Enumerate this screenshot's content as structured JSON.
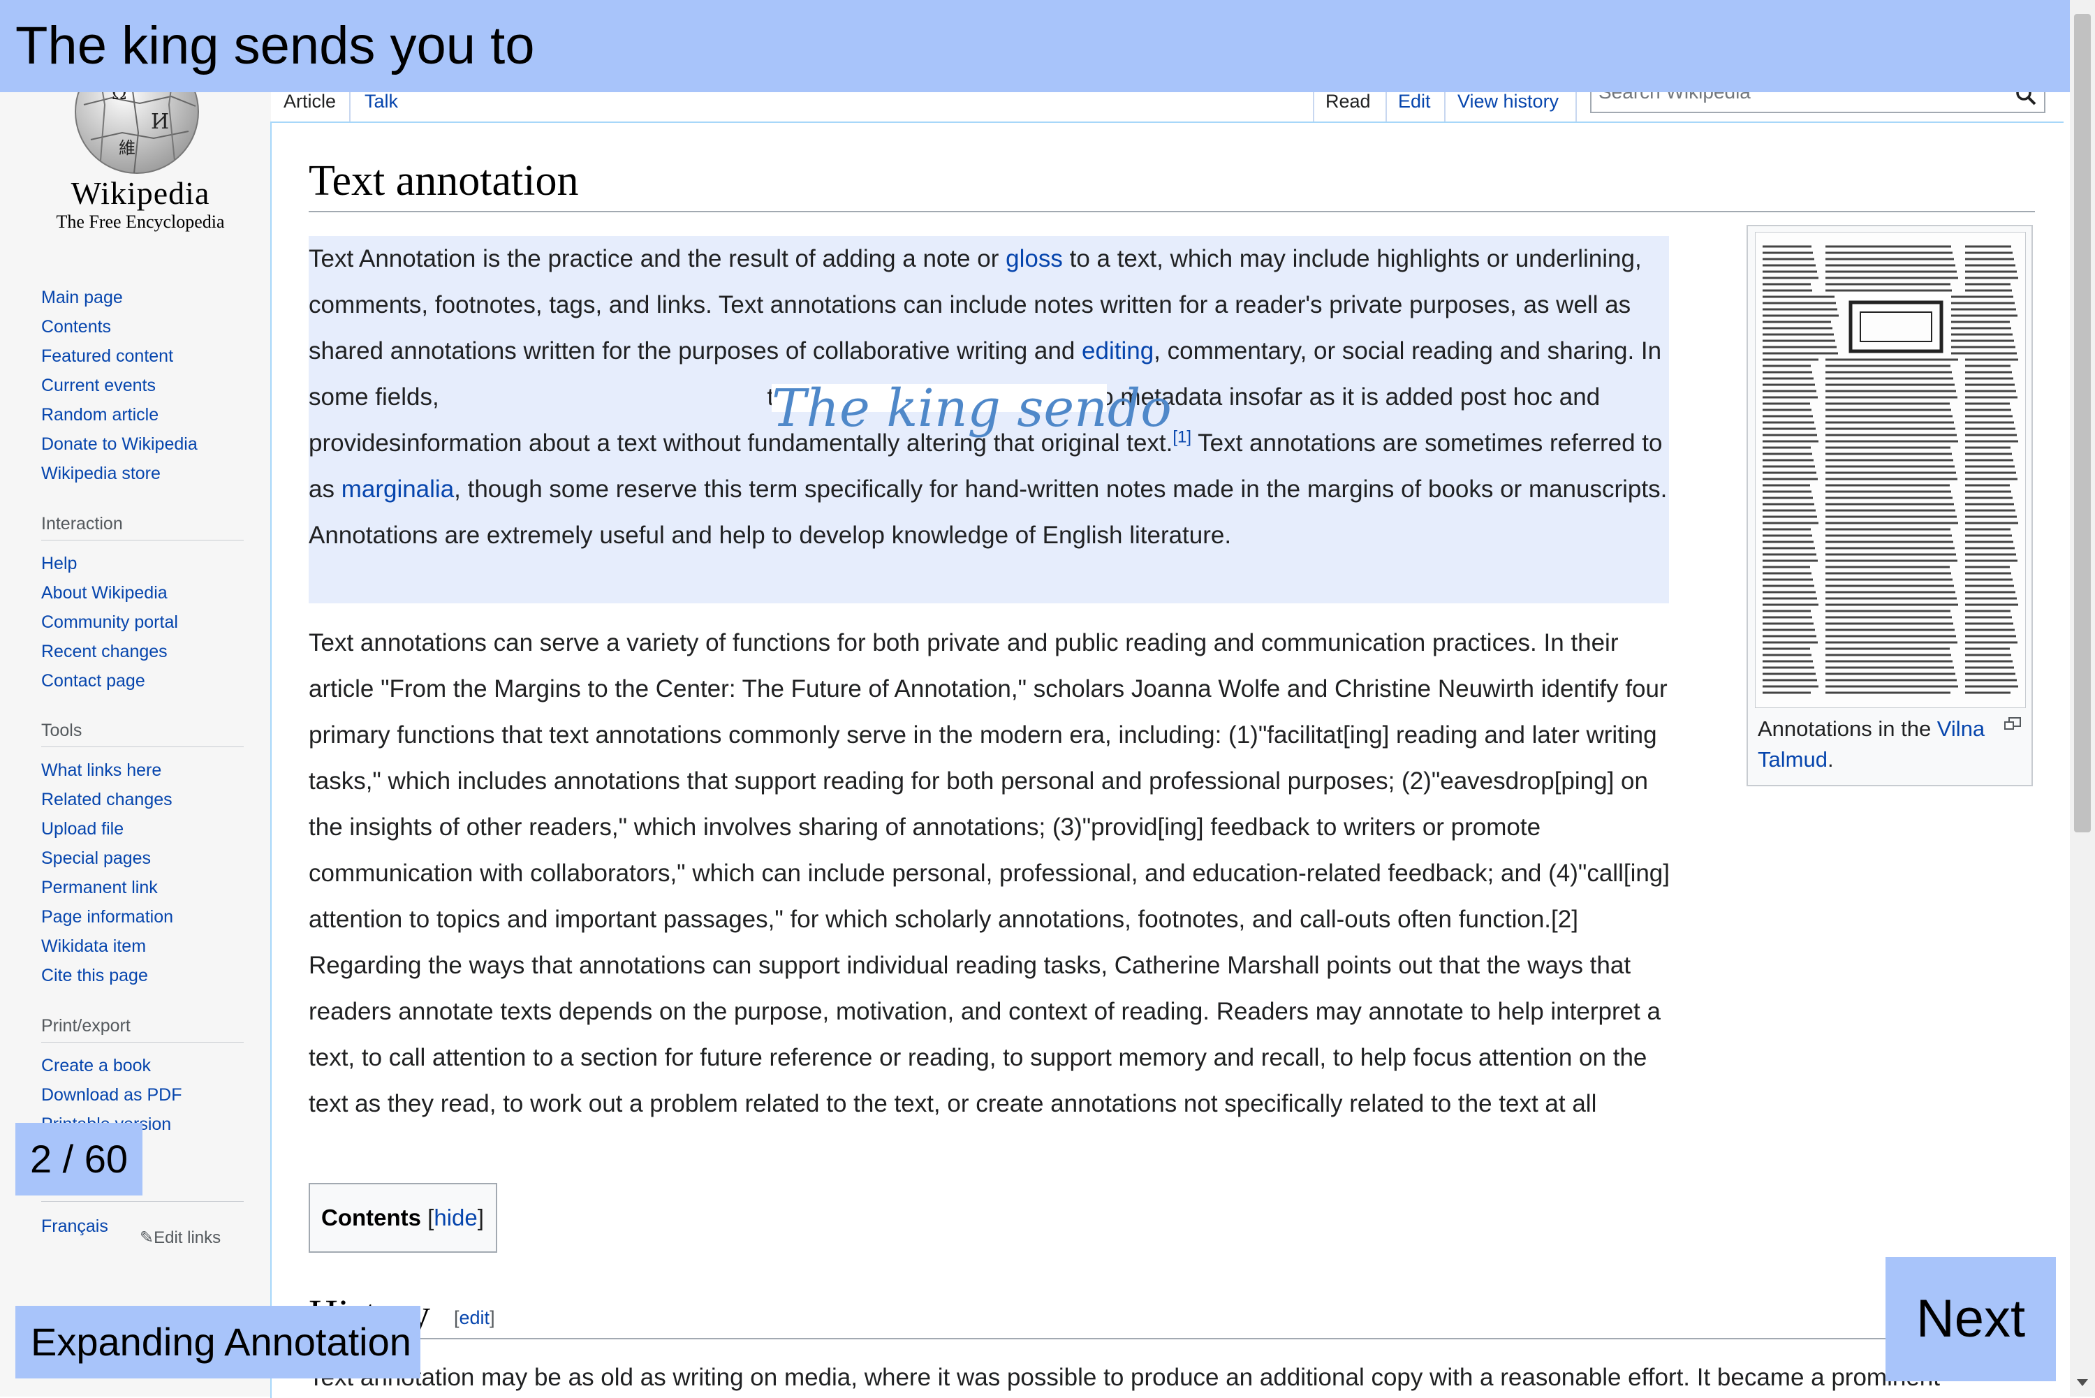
{
  "overlay": {
    "banner_text": "The king sends you to",
    "counter": "2 / 60",
    "mode_label": "Expanding Annotation",
    "next_label": "Next",
    "accent_color": "#a8c4fa"
  },
  "logo": {
    "wordmark": "Wikipedia",
    "tagline": "The Free Encyclopedia"
  },
  "sidebar": {
    "main": [
      "Main page",
      "Contents",
      "Featured content",
      "Current events",
      "Random article",
      "Donate to Wikipedia",
      "Wikipedia store"
    ],
    "interaction": {
      "heading": "Interaction",
      "items": [
        "Help",
        "About Wikipedia",
        "Community portal",
        "Recent changes",
        "Contact page"
      ]
    },
    "tools": {
      "heading": "Tools",
      "items": [
        "What links here",
        "Related changes",
        "Upload file",
        "Special pages",
        "Permanent link",
        "Page information",
        "Wikidata item",
        "Cite this page"
      ]
    },
    "print": {
      "heading": "Print/export",
      "items": [
        "Create a book",
        "Download as PDF",
        "Printable version"
      ]
    },
    "languages": [
      "Français"
    ],
    "edit_links": "Edit links"
  },
  "tabs": {
    "article": "Article",
    "talk": "Talk",
    "read": "Read",
    "edit": "Edit",
    "view_history": "View history"
  },
  "search": {
    "placeholder": "Search Wikipedia"
  },
  "article": {
    "title": "Text annotation",
    "para1": {
      "t1": "Text Annotation is the practice and the result of adding a note or ",
      "l1": "gloss",
      "t2": " to a text, which may include highlights or underlining, comments, footnotes, tags, and links. Text annotations can include notes written for a reader's private purposes, as well as shared annotations written for the purposes of collaborative writing and ",
      "l2": "editing",
      "t3": ", commentary, or social reading and sharing. In some fields,",
      "t4": " text annotation is comparable to metadata insofar as it is added post hoc and providesinformation about a text without fundamentally altering that original text.",
      "ref": "[1]",
      "t5": " Text annotations are sometimes referred to as ",
      "l3": "marginalia",
      "t6": ", though some reserve this term specifically for hand-written notes made in the margins of books or manuscripts. Annotations are extremely useful and help to develop knowledge of English literature."
    },
    "handwriting": "The king sendo",
    "para2": "Text annotations can serve a variety of functions for both private and public reading and communication practices. In their article \"From the Margins to the Center: The Future of Annotation,\" scholars Joanna Wolfe and Christine Neuwirth identify four primary functions that text annotations commonly serve in the modern era, including: (1)\"facilitat[ing] reading and later writing tasks,\" which includes annotations that support reading for both personal and professional purposes; (2)\"eavesdrop[ping] on the insights of other readers,\" which involves sharing of annotations; (3)\"provid[ing] feedback to writers or promote communication with collaborators,\" which can include personal, professional, and education-related feedback; and (4)\"call[ing] attention to topics and important passages,\" for which scholarly annotations, footnotes, and call-outs often function.[2] Regarding the ways that annotations can support individual reading tasks, Catherine Marshall points out that the ways that readers annotate texts depends on the purpose, motivation, and context of reading. Readers may annotate to help interpret a text, to call attention to a section for future reference or reading, to support memory and recall, to help focus attention on the text as they read, to work out a problem related to the text, or create annotations not specifically related to the text at all",
    "caption_prefix": "Annotations in the ",
    "caption_link": "Vilna Talmud",
    "caption_suffix": ".",
    "toc_title": "Contents",
    "toc_hide": "hide",
    "section_heading": "History",
    "section_edit": "edit",
    "para3": "Text annotation may be as old as writing on media, where it was possible to produce an additional copy with a reasonable effort. It became a prominent"
  },
  "colors": {
    "link": "#0645ad",
    "highlight": "#e6edfc",
    "handwriting_ink": "#4f88c9"
  }
}
